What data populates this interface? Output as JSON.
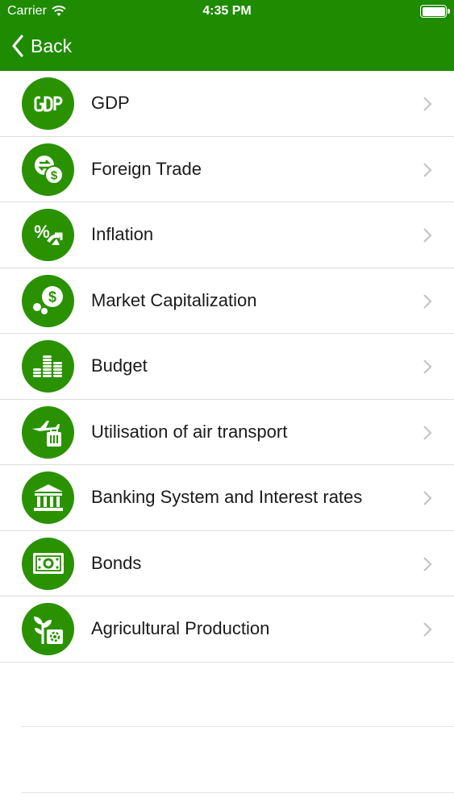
{
  "status_bar": {
    "carrier": "Carrier",
    "time": "4:35 PM"
  },
  "nav": {
    "back_label": "Back"
  },
  "theme": {
    "accent": "#1e8b00",
    "icon_bg": "#2a9200"
  },
  "items": [
    {
      "label": "GDP",
      "icon": "gdp-icon"
    },
    {
      "label": "Foreign Trade",
      "icon": "currency-exchange-icon"
    },
    {
      "label": "Inflation",
      "icon": "percent-arrow-icon"
    },
    {
      "label": "Market Capitalization",
      "icon": "coins-dollar-icon"
    },
    {
      "label": "Budget",
      "icon": "coin-stacks-icon"
    },
    {
      "label": "Utilisation of air transport",
      "icon": "airplane-luggage-icon"
    },
    {
      "label": "Banking System and Interest rates",
      "icon": "bank-building-icon"
    },
    {
      "label": "Bonds",
      "icon": "bond-certificate-icon"
    },
    {
      "label": "Agricultural Production",
      "icon": "plant-gear-icon"
    }
  ]
}
